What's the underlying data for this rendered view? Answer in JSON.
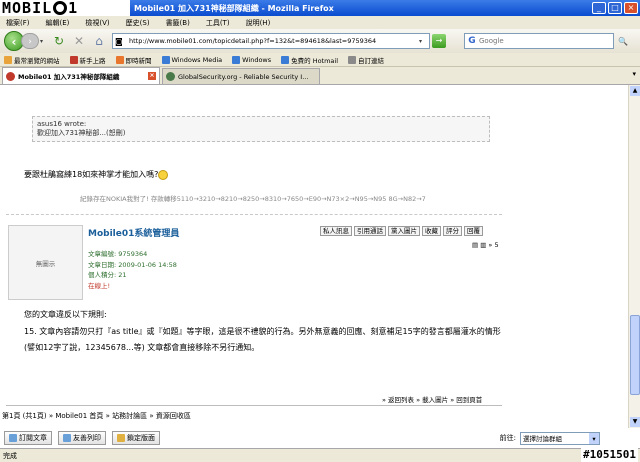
{
  "window": {
    "title": "Mobile01 加入731神秘部隊組織 - Mozilla Firefox",
    "watermark_text": "mobile01"
  },
  "menu": [
    "檔案(F)",
    "編輯(E)",
    "檢視(V)",
    "歷史(S)",
    "書籤(B)",
    "工具(T)",
    "說明(H)"
  ],
  "nav": {
    "url": "http://www.mobile01.com/topicdetail.php?f=132&t=894618&last=9759364",
    "search_placeholder": "Google"
  },
  "bookmarks": [
    "最常瀏覽的網站",
    "新手上路",
    "即時新聞",
    "Windows Media",
    "Windows",
    "免費的 Hotmail",
    "自訂連結"
  ],
  "tabs": [
    {
      "label": "Mobile01 加入731神秘部隊組織",
      "active": true
    },
    {
      "label": "GlobalSecurity.org - Reliable Security I...",
      "active": false
    }
  ],
  "post": {
    "quote_author": "asus16 wrote:",
    "quote_text": "歡迎加入731神秘部...(恕刪)",
    "reply_text": "要跟杜鵑窩練18如來神掌才能加入嗎?",
    "signature": "紀錄存在NOKIA我對了! 存款轉移5110→3210→8210→8250→8310→7650→E90→N73×2→N95→N95 8G→N82→7",
    "username": "Mobile01系統管理員",
    "actions": [
      "私人訊息",
      "引用通話",
      "黨入圖片",
      "收藏",
      "評分",
      "回覆"
    ],
    "pager_small": "▤ ▥ » 5",
    "avatar_text": "無圖示",
    "info": [
      {
        "k": "文章編號:",
        "v": "9759364"
      },
      {
        "k": "文章日期:",
        "v": "2009-01-06 14:58"
      },
      {
        "k": "個人積分:",
        "v": "21"
      }
    ],
    "online": "在線上!",
    "warn_title": "您的文章違反以下規則:",
    "warn_body": "15. 文章內容請勿只打『as title』或『如題』等字眼，這是很不禮貌的行為。另外無意義的回應、刻意補足15字的發言都屬灌水的情形 (譬如12字了說，12345678...等) 文章都會直接移除不另行通知。",
    "footer": "» 返回列表 » 載入圖片 » 回到頁首"
  },
  "breadcrumb": "第1頁 (共1頁) » Mobile01 首頁 » 站務討論區 » 資源回收區",
  "bottom_tools": [
    "訂閱文章",
    "友善列印",
    "鎖定版面"
  ],
  "jump": {
    "label": "前往:",
    "value": "選擇討論群組"
  },
  "status": "完成",
  "stamp": "#1051501"
}
